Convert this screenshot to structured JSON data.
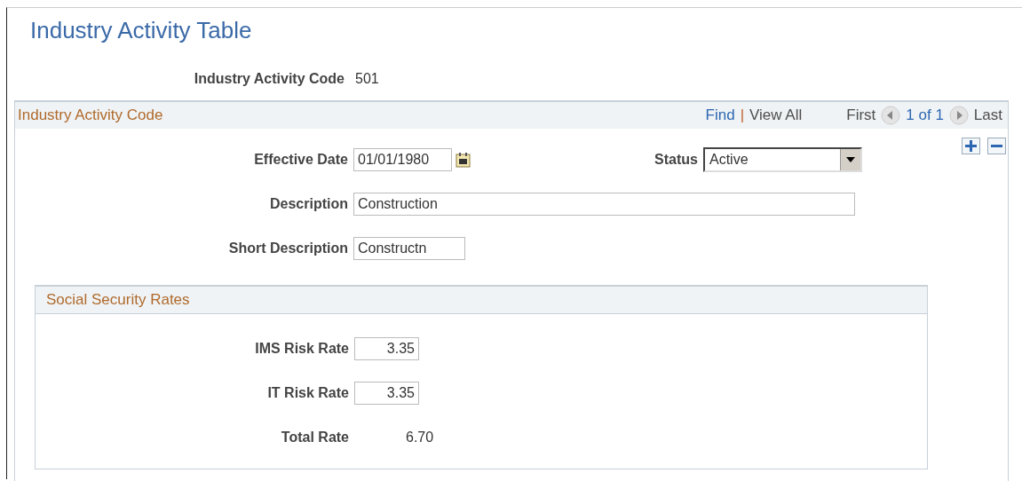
{
  "page_title": "Industry Activity Table",
  "key_field": {
    "label": "Industry Activity Code",
    "value": "501"
  },
  "section": {
    "title": "Industry Activity Code",
    "nav": {
      "find": "Find",
      "separator": "|",
      "view_all": "View All",
      "first": "First",
      "counter": "1 of 1",
      "last": "Last"
    },
    "effective_date": {
      "label": "Effective Date",
      "value": "01/01/1980"
    },
    "status": {
      "label": "Status",
      "value": "Active"
    },
    "description": {
      "label": "Description",
      "value": "Construction"
    },
    "short_description": {
      "label": "Short Description",
      "value": "Constructn"
    },
    "subsection": {
      "title": "Social Security Rates",
      "rows": [
        {
          "kind": "input",
          "label": "IMS Risk Rate",
          "value": "3.35"
        },
        {
          "kind": "input",
          "label": "IT Risk Rate",
          "value": "3.35"
        },
        {
          "kind": "display",
          "label": "Total Rate",
          "value": "6.70"
        }
      ]
    }
  }
}
